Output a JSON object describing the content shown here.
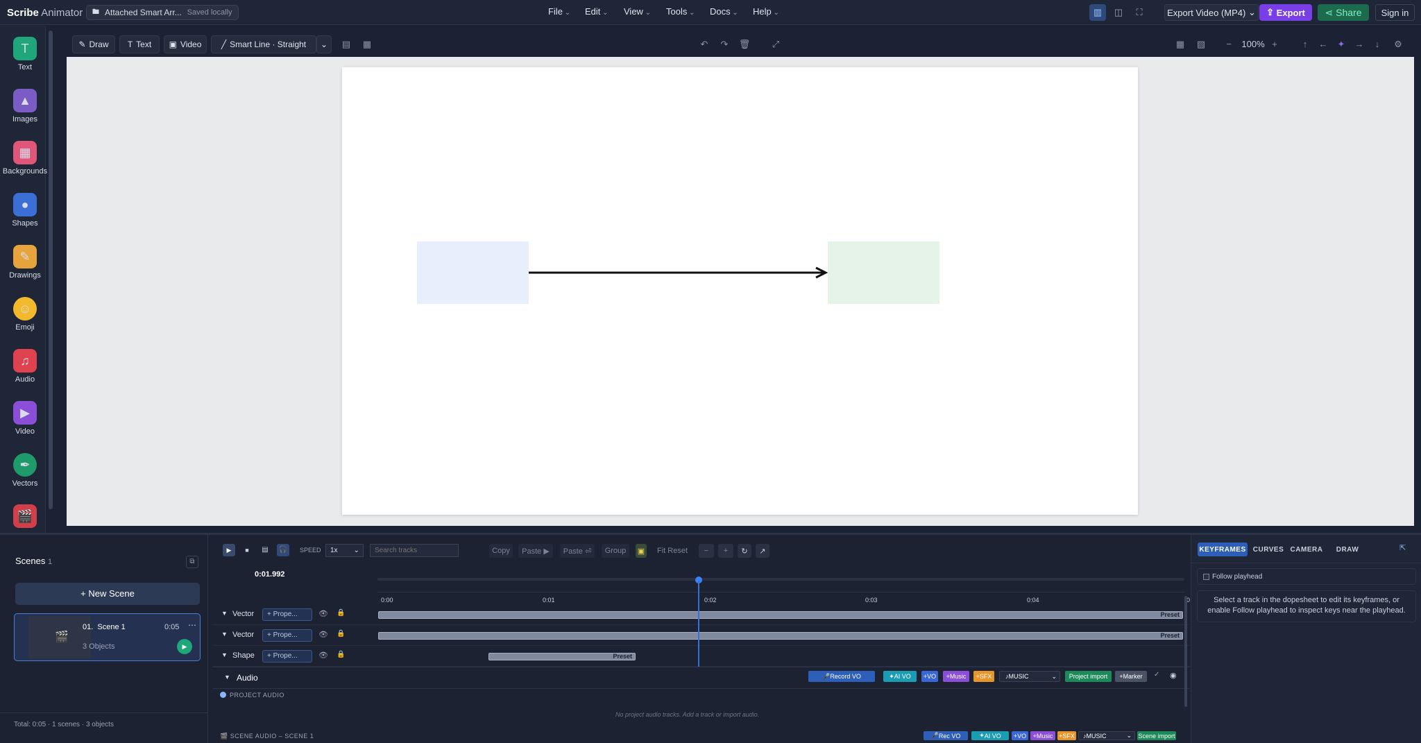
{
  "app": {
    "brand": "Scribe",
    "product": "Animator"
  },
  "document": {
    "name": "Attached Smart Arr...",
    "status": "Saved locally"
  },
  "menus": [
    "File",
    "Edit",
    "View",
    "Tools",
    "Docs",
    "Help"
  ],
  "top_actions": {
    "export_format": "Export Video (MP4)",
    "export": "Export",
    "share": "Share",
    "sign_in": "Sign in"
  },
  "rail": [
    {
      "label": "Text",
      "icon": "text-icon",
      "color": "#1fa67a"
    },
    {
      "label": "Images",
      "icon": "images-icon",
      "color": "#7a5cc4"
    },
    {
      "label": "Backgrounds",
      "icon": "backgrounds-icon",
      "color": "#e0567a"
    },
    {
      "label": "Shapes",
      "icon": "shapes-icon",
      "color": "#3b6fd6"
    },
    {
      "label": "Drawings",
      "icon": "drawings-icon",
      "color": "#e8a43c"
    },
    {
      "label": "Emoji",
      "icon": "emoji-icon",
      "color": "#f2b92c"
    },
    {
      "label": "Audio",
      "icon": "audio-icon",
      "color": "#e0414f"
    },
    {
      "label": "Video",
      "icon": "video-icon",
      "color": "#8a4fd6"
    },
    {
      "label": "Vectors",
      "icon": "vectors-icon",
      "color": "#1f9a6a"
    }
  ],
  "toolbar": {
    "draw": "Draw",
    "text": "Text",
    "video": "Video",
    "smart_line": "Smart Line · Straight",
    "zoom": "100%"
  },
  "scenes": {
    "title": "Scenes",
    "count": "1",
    "new_scene": "+ New Scene",
    "items": [
      {
        "index": "01.",
        "name": "Scene 1",
        "duration": "0:05",
        "objects": "3 Objects"
      }
    ],
    "footer": "Total: 0:05 · 1 scenes · 3 objects"
  },
  "timeline": {
    "speed_label": "SPEED",
    "speed_value": "1x",
    "search_placeholder": "Search tracks",
    "actions": [
      "Copy",
      "Paste ▶",
      "Paste ⏎",
      "Group",
      "Fit Reset"
    ],
    "time": "0:01.992",
    "ruler": [
      "0:00",
      "0:01",
      "0:02",
      "0:03",
      "0:04",
      "0"
    ],
    "tracks": [
      {
        "name": "Vector",
        "prop": "Prope...",
        "preset": "Preset"
      },
      {
        "name": "Vector",
        "prop": "Prope...",
        "preset": "Preset"
      },
      {
        "name": "Shape",
        "prop": "Prope...",
        "preset": "Preset"
      }
    ],
    "audio_label": "Audio",
    "audio_tags": {
      "record": "Record VO",
      "ai": "AI VO",
      "vo": "+VO",
      "music": "+Music",
      "sfx": "+SFX",
      "music_select": "MUSIC",
      "project_import": "Project import",
      "marker": "+Marker"
    },
    "project_audio": "PROJECT AUDIO",
    "empty_audio": "No project audio tracks. Add a track or import audio.",
    "scene_audio": "SCENE AUDIO – SCENE 1",
    "scene_tags": {
      "rec": "Rec VO",
      "ai": "AI VO",
      "vo": "+VO",
      "music": "+Music",
      "sfx": "+SFX",
      "music_select": "MUSIC",
      "scene_import": "Scene import"
    }
  },
  "right_panel": {
    "tabs": [
      "KEYFRAMES",
      "CURVES",
      "CAMERA",
      "DRAW"
    ],
    "follow": "Follow playhead",
    "hint": "Select a track in the dopesheet to edit its keyframes, or enable Follow playhead to inspect keys near the playhead."
  }
}
